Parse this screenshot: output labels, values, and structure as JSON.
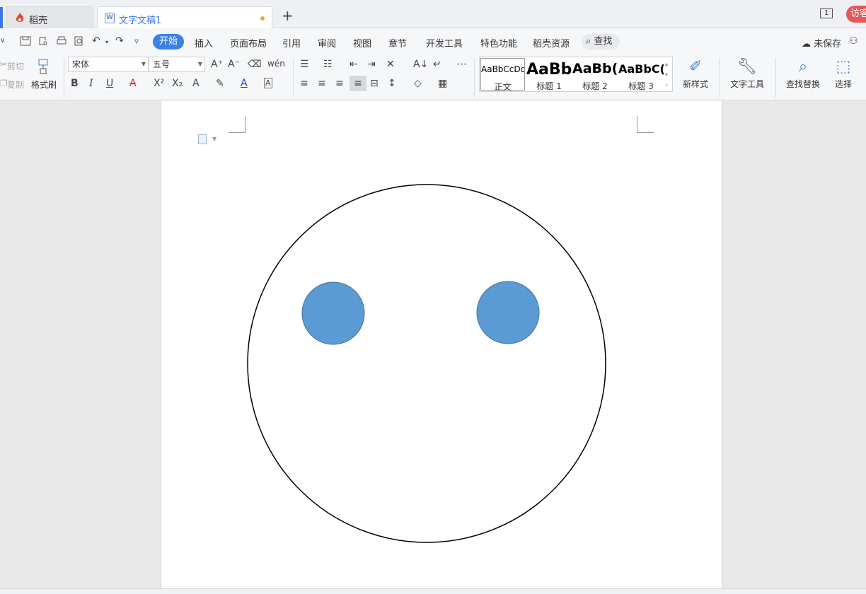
{
  "tabs": {
    "home_label": "稻壳",
    "doc_label": "文字文稿1",
    "new_tab_symbol": "+",
    "window_count": "1",
    "visitor_label": "访客"
  },
  "menu": {
    "items": [
      "开始",
      "插入",
      "页面布局",
      "引用",
      "审阅",
      "视图",
      "章节",
      "开发工具",
      "特色功能",
      "稻壳资源"
    ],
    "search_label": "查找",
    "unsaved_label": "未保存"
  },
  "ribbon": {
    "cut_label": "剪切",
    "copy_label": "复制",
    "format_painter_label": "格式刷",
    "font_name": "宋体",
    "font_size": "五号",
    "styles": [
      {
        "sample": "AaBbCcDd",
        "name": "正文"
      },
      {
        "sample": "AaBb",
        "name": "标题 1"
      },
      {
        "sample": "AaBb(",
        "name": "标题 2"
      },
      {
        "sample": "AaBbC(",
        "name": "标题 3"
      }
    ],
    "new_style_label": "新样式",
    "text_tools_label": "文字工具",
    "find_replace_label": "查找替换",
    "select_label": "选择"
  },
  "drawing": {
    "face_outline_color": "#000000",
    "eye_fill_color": "#5b9bd5",
    "eye_stroke_color": "#41719c",
    "shapes": [
      "face-circle",
      "left-eye",
      "right-eye"
    ]
  }
}
